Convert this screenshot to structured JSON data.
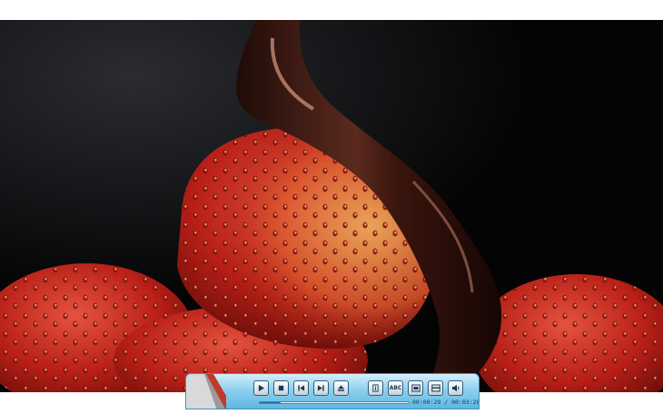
{
  "player": {
    "current_time": "00:00:29",
    "separator": "/",
    "total_time": "00:03:20",
    "progress": 0.14,
    "accent_color": "#5fb6e0"
  },
  "controls": [
    {
      "name": "play-button",
      "icon": "play-icon"
    },
    {
      "name": "stop-button",
      "icon": "stop-icon"
    },
    {
      "name": "previous-button",
      "icon": "skip-back-icon"
    },
    {
      "name": "next-button",
      "icon": "skip-forward-icon"
    },
    {
      "name": "eject-button",
      "icon": "eject-icon"
    },
    {
      "name": "info-button",
      "icon": "info-icon"
    },
    {
      "name": "subtitles-button",
      "label": "ABC",
      "icon": "subtitles-icon"
    },
    {
      "name": "aspect-button",
      "icon": "aspect-ratio-icon"
    },
    {
      "name": "fullscreen-button",
      "icon": "fullscreen-icon"
    },
    {
      "name": "volume-button",
      "icon": "speaker-icon"
    }
  ]
}
